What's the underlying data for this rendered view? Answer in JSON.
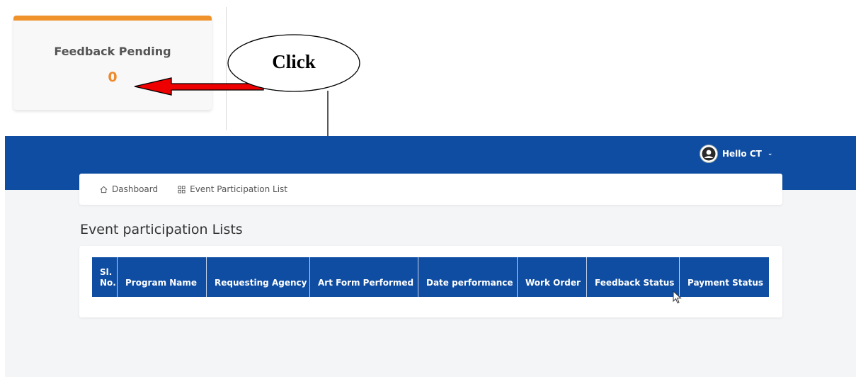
{
  "widget": {
    "title": "Feedback Pending",
    "value": "0",
    "accent_color": "#f0922b",
    "value_color": "#ee8a2d"
  },
  "annotation": {
    "label": "Click",
    "arrow_fill": "#ee0000"
  },
  "header": {
    "bg_color": "#0f4da2",
    "user_greeting": "Hello CT",
    "avatar_icon": "user-avatar-icon",
    "dropdown_icon": "chevron-down-icon"
  },
  "breadcrumb": {
    "items": [
      {
        "label": "Dashboard",
        "icon": "home-icon"
      },
      {
        "label": "Event Participation List",
        "icon": "grid-icon"
      }
    ]
  },
  "page": {
    "title": "Event participation Lists"
  },
  "table": {
    "columns": [
      "Sl. No.",
      "Program Name",
      "Requesting Agency",
      "Art Form Performed",
      "Date performance",
      "Work Order",
      "Feedback Status",
      "Payment Status"
    ],
    "rows": []
  }
}
